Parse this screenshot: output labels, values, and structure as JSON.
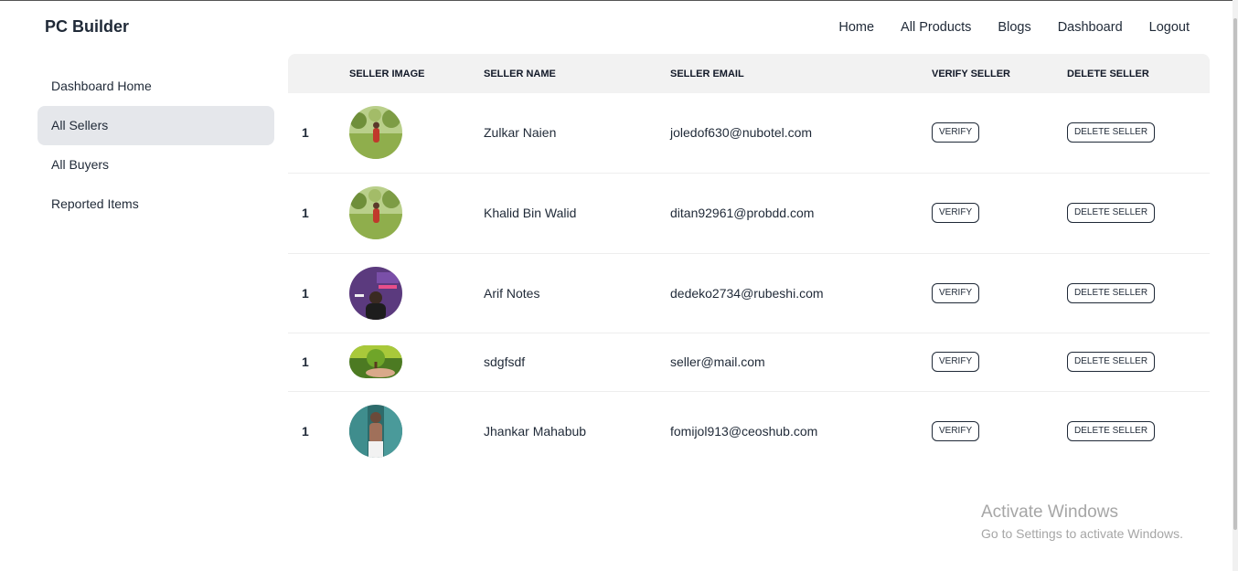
{
  "brand": "PC Builder",
  "nav": [
    "Home",
    "All Products",
    "Blogs",
    "Dashboard",
    "Logout"
  ],
  "sidebar": {
    "items": [
      {
        "label": "Dashboard Home",
        "active": false
      },
      {
        "label": "All Sellers",
        "active": true
      },
      {
        "label": "All Buyers",
        "active": false
      },
      {
        "label": "Reported Items",
        "active": false
      }
    ]
  },
  "table": {
    "headers": [
      "",
      "Seller Image",
      "Seller Name",
      "Seller Email",
      "Verify Seller",
      "Delete Seller"
    ],
    "rows": [
      {
        "index": "1",
        "name": "Zulkar Naien",
        "email": "joledof630@nubotel.com",
        "image": "child-on-lawn-photo",
        "verify": "Verify",
        "delete": "Delete Seller"
      },
      {
        "index": "1",
        "name": "Khalid Bin Walid",
        "email": "ditan92961@probdd.com",
        "image": "child-on-lawn-photo",
        "verify": "Verify",
        "delete": "Delete Seller"
      },
      {
        "index": "1",
        "name": "Arif Notes",
        "email": "dedeko2734@rubeshi.com",
        "image": "purple-banner-portrait",
        "verify": "Verify",
        "delete": "Delete Seller"
      },
      {
        "index": "1",
        "name": "sdgfsdf",
        "email": "seller@mail.com",
        "image": "tree-in-hand-photo",
        "verify": "Verify",
        "delete": "Delete Seller"
      },
      {
        "index": "1",
        "name": "Jhankar Mahabub",
        "email": "fomijol913@ceoshub.com",
        "image": "man-standing-photo",
        "verify": "Verify",
        "delete": "Delete Seller"
      }
    ]
  },
  "watermark": {
    "line1": "Activate Windows",
    "line2": "Go to Settings to activate Windows."
  }
}
